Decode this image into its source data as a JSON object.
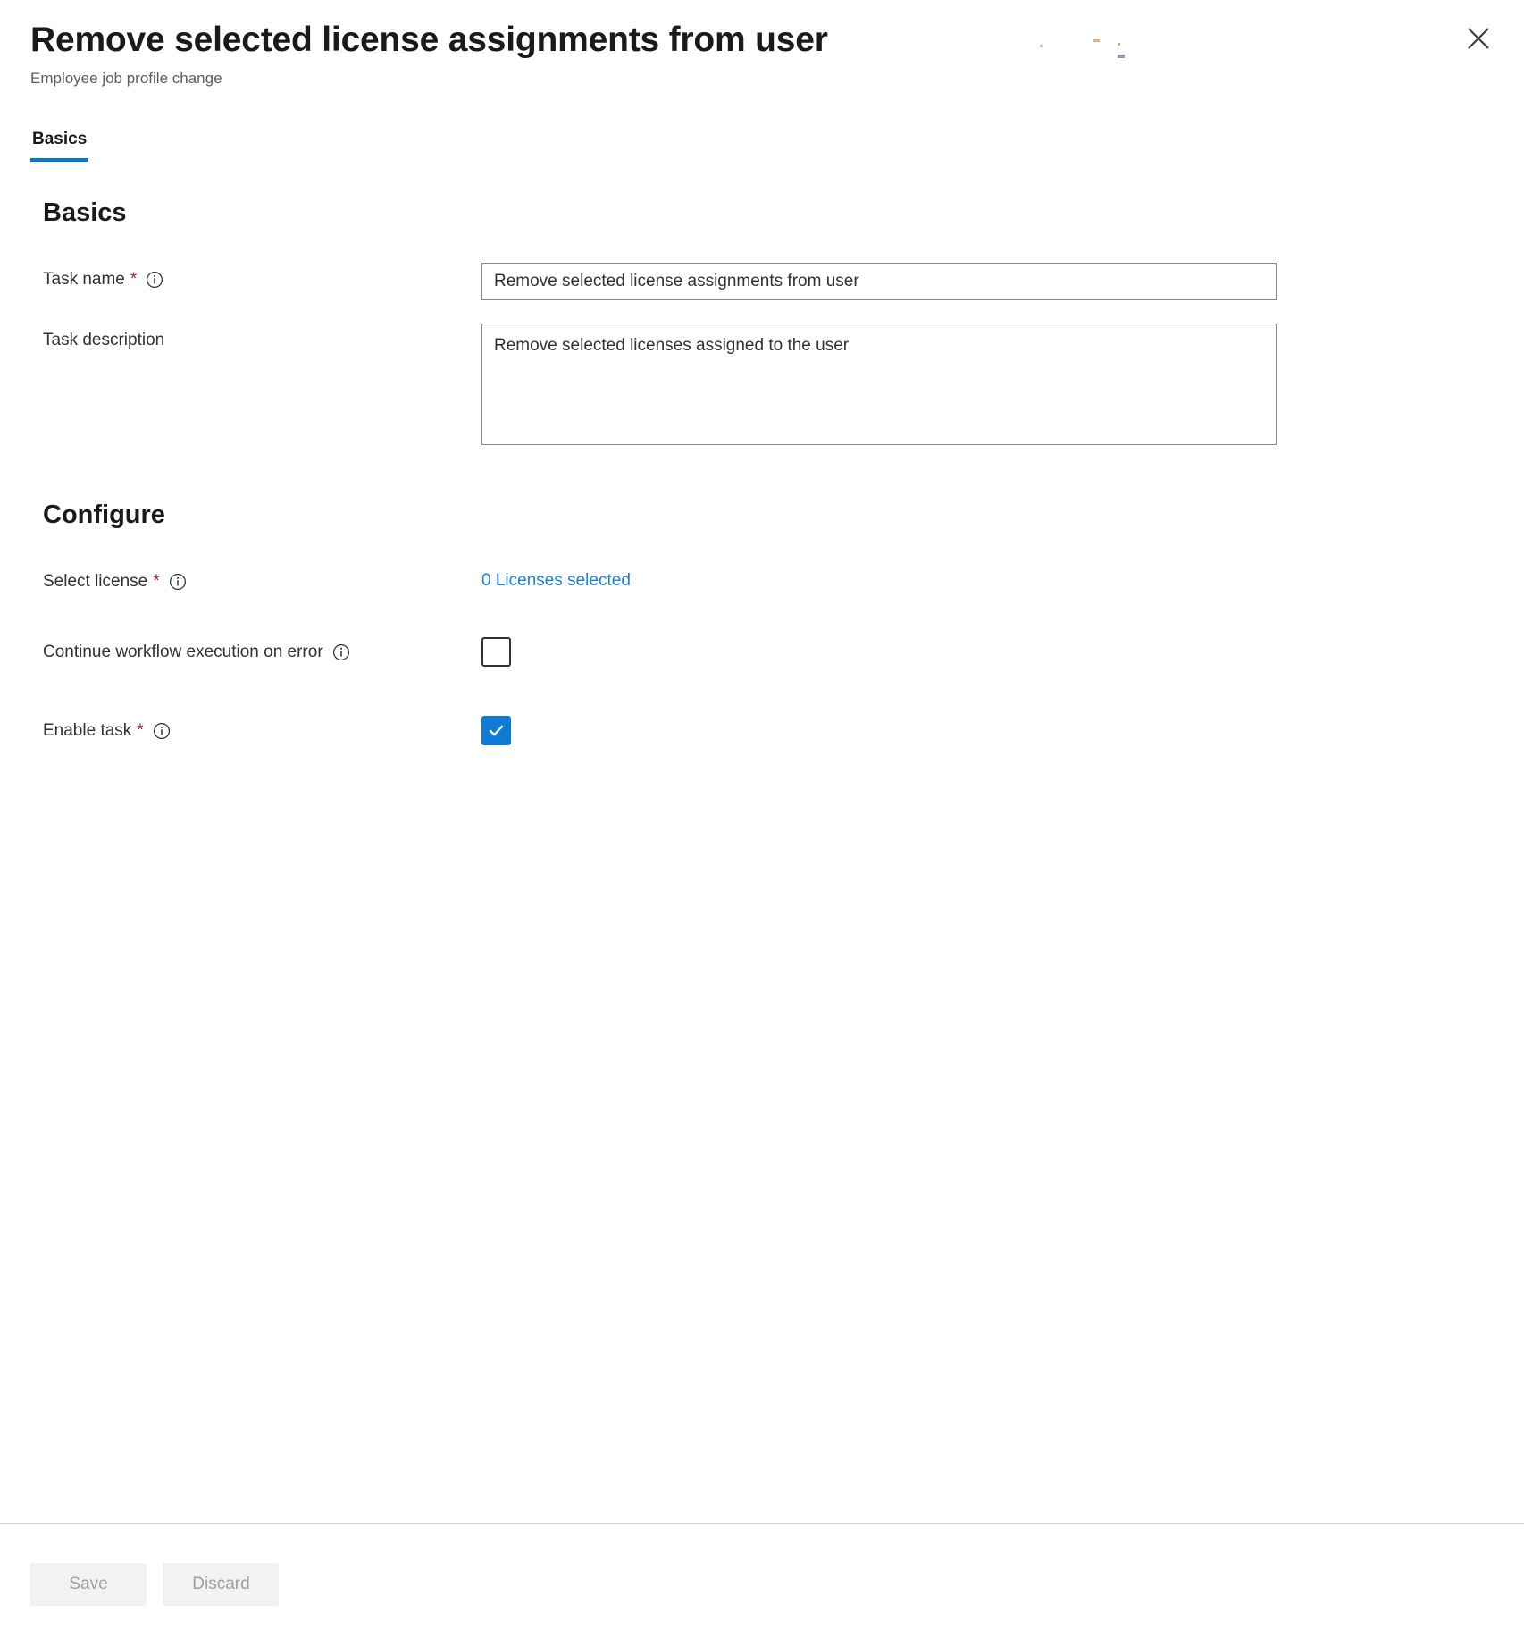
{
  "header": {
    "title": "Remove selected license assignments from user",
    "subtitle": "Employee job profile change",
    "close_label": "Close"
  },
  "tabs": [
    {
      "label": "Basics",
      "selected": true
    }
  ],
  "sections": {
    "basics": {
      "heading": "Basics",
      "task_name": {
        "label": "Task name",
        "required": "*",
        "value": "Remove selected license assignments from user",
        "placeholder": "Task name"
      },
      "task_description": {
        "label": "Task description",
        "value": "Remove selected licenses assigned to the user",
        "placeholder": "Task description"
      }
    },
    "configure": {
      "heading": "Configure",
      "select_license": {
        "label": "Select license",
        "required": "*",
        "link_text": "0 Licenses selected"
      },
      "continue_on_error": {
        "label": "Continue workflow execution on error",
        "checked": false
      },
      "enable_task": {
        "label": "Enable task",
        "required": "*",
        "checked": true
      }
    }
  },
  "footer": {
    "save_label": "Save",
    "discard_label": "Discard"
  },
  "colors": {
    "accent": "#0078d4",
    "link": "#1a7fd4",
    "checkbox_checked": "#0f7bd4",
    "required": "#a4262c",
    "border": "#8a8886"
  }
}
